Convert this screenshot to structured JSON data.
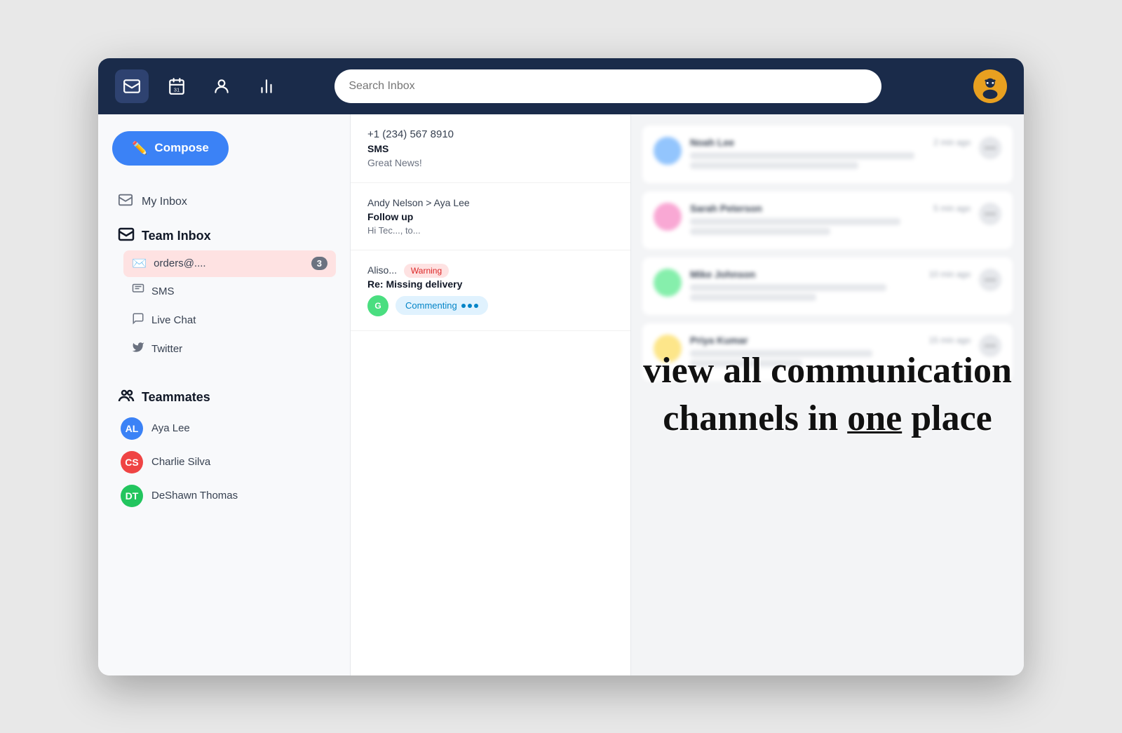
{
  "nav": {
    "search_placeholder": "Search Inbox",
    "icons": [
      "inbox-icon",
      "calendar-icon",
      "contacts-icon",
      "analytics-icon"
    ]
  },
  "sidebar": {
    "compose_label": "Compose",
    "my_inbox_label": "My Inbox",
    "team_inbox_label": "Team Inbox",
    "inbox_sub_items": [
      {
        "label": "orders@....",
        "icon": "email",
        "badge": "3",
        "active": true
      },
      {
        "label": "SMS",
        "icon": "sms",
        "active": false
      },
      {
        "label": "Live Chat",
        "icon": "chat",
        "active": false
      },
      {
        "label": "Twitter",
        "icon": "twitter",
        "active": false
      }
    ],
    "teammates_label": "Teammates",
    "teammates": [
      {
        "name": "Aya Lee",
        "color": "#3b82f6",
        "initials": "AL"
      },
      {
        "name": "Charlie Silva",
        "color": "#ef4444",
        "initials": "CS"
      },
      {
        "name": "DeShawn Thomas",
        "color": "#22c55e",
        "initials": "DT"
      }
    ]
  },
  "conversations": [
    {
      "phone": "+1 (234) 567 8910",
      "type": "SMS",
      "preview": "Great News!"
    },
    {
      "from": "Andy Nelson > Aya Lee",
      "subject": "Follow up",
      "body": "Hi Tec..., to...",
      "tags": [],
      "has_commenting": false
    },
    {
      "from": "Aliso... Warning",
      "subject": "Re: Missing delivery",
      "body": "",
      "tags": [
        "Warning"
      ],
      "has_commenting": true,
      "commenter_initials": "G",
      "commenter_color": "#22c55e"
    }
  ],
  "right_panel": {
    "items": [
      {
        "name": "Noah Lee",
        "time": "2 min ago",
        "avatar_color": "#93c5fd"
      },
      {
        "name": "Sarah Peterson",
        "time": "5 min ago",
        "avatar_color": "#f9a8d4"
      },
      {
        "name": "Mike Johnson",
        "time": "10 min ago",
        "avatar_color": "#86efac"
      },
      {
        "name": "Priya Kumar",
        "time": "15 min ago",
        "avatar_color": "#fde68a"
      }
    ]
  },
  "overlay": {
    "line1": "view all communication",
    "line2": "channels in one place"
  }
}
